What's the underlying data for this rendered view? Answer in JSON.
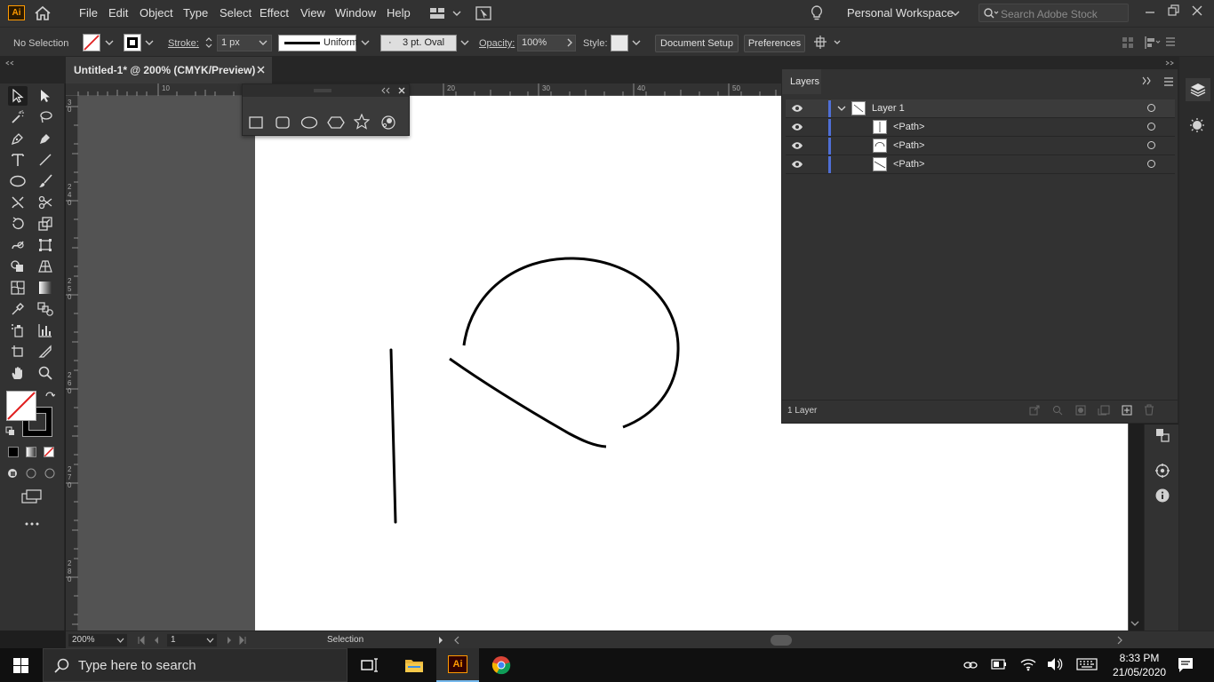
{
  "app": {
    "logo": "Ai",
    "menu": [
      "File",
      "Edit",
      "Object",
      "Type",
      "Select",
      "Effect",
      "View",
      "Window",
      "Help"
    ],
    "workspace": "Personal Workspace",
    "search_placeholder": "Search Adobe Stock"
  },
  "control_bar": {
    "selection": "No Selection",
    "stroke_label": "Stroke:",
    "stroke_value": "1 px",
    "profile": "Uniform",
    "brush": "3 pt. Oval",
    "opacity_label": "Opacity:",
    "opacity_value": "100%",
    "style_label": "Style:",
    "document_setup": "Document Setup",
    "preferences": "Preferences"
  },
  "document": {
    "tab_title": "Untitled-1* @ 200% (CMYK/Preview)"
  },
  "rulers": {
    "horizontal": [
      "10",
      "20",
      "30",
      "40",
      "50"
    ],
    "vertical": [
      "3 0",
      "2 4 0",
      "2 5 0",
      "2 6 0",
      "2 7 0",
      "2 8 0"
    ]
  },
  "layers_panel": {
    "tab": "Layers",
    "layers": [
      {
        "name": "Layer 1",
        "level": 0
      },
      {
        "name": "<Path>",
        "level": 1
      },
      {
        "name": "<Path>",
        "level": 1
      },
      {
        "name": "<Path>",
        "level": 1
      }
    ],
    "footer": "1 Layer"
  },
  "status_bar": {
    "zoom": "200%",
    "artboard": "1",
    "tool": "Selection"
  },
  "taskbar": {
    "search_placeholder": "Type here to search",
    "time": "8:33 PM",
    "date": "21/05/2020",
    "active_app": "Ai"
  },
  "colors": {
    "layer_color": "#4f6fd6",
    "ai_brand": "#ff9a00",
    "canvas": "#535353"
  }
}
